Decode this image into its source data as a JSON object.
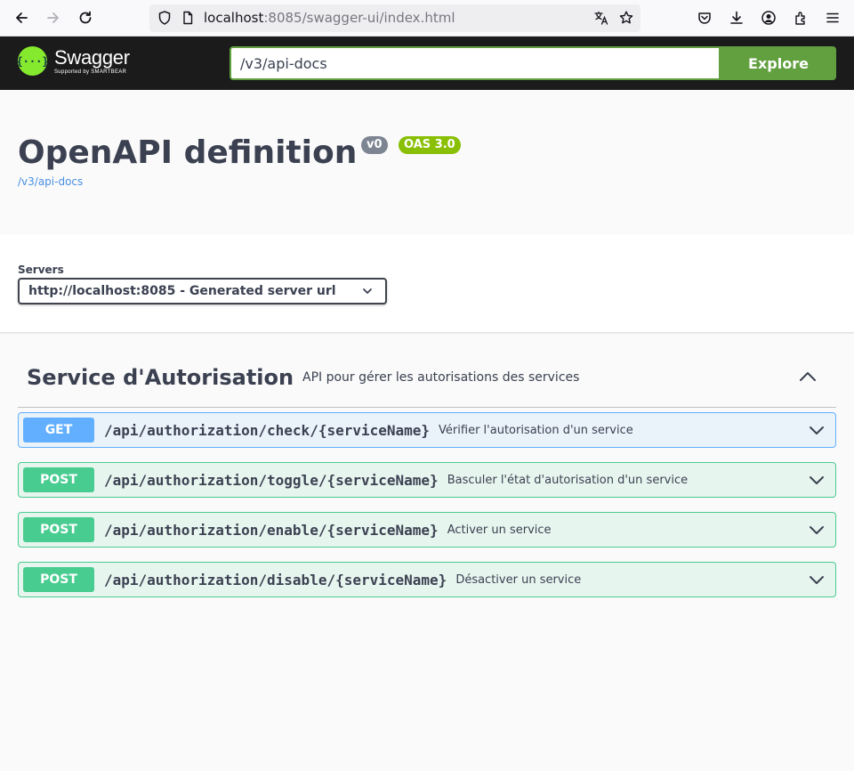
{
  "browser": {
    "url_host": "localhost",
    "url_rest": ":8085/swagger-ui/index.html"
  },
  "topbar": {
    "logo_name": "Swagger",
    "logo_sub": "Supported by SMARTBEAR",
    "logo_mark": "{···}",
    "spec_url": "/v3/api-docs",
    "explore_label": "Explore"
  },
  "info": {
    "title": "OpenAPI definition",
    "version_badge": "v0",
    "oas_badge": "OAS 3.0",
    "link": "/v3/api-docs"
  },
  "servers": {
    "label": "Servers",
    "selected": "http://localhost:8085 - Generated server url"
  },
  "tag": {
    "name": "Service d'Autorisation",
    "description": "API pour gérer les autorisations des services",
    "operations": [
      {
        "method": "GET",
        "path": "/api/authorization/check/{serviceName}",
        "summary": "Vérifier l'autorisation d'un service"
      },
      {
        "method": "POST",
        "path": "/api/authorization/toggle/{serviceName}",
        "summary": "Basculer l'état d'autorisation d'un service"
      },
      {
        "method": "POST",
        "path": "/api/authorization/enable/{serviceName}",
        "summary": "Activer un service"
      },
      {
        "method": "POST",
        "path": "/api/authorization/disable/{serviceName}",
        "summary": "Désactiver un service"
      }
    ]
  },
  "colors": {
    "get": "#61affe",
    "post": "#49cc90",
    "explore": "#62a03f",
    "topbar": "#1b1b1b"
  }
}
